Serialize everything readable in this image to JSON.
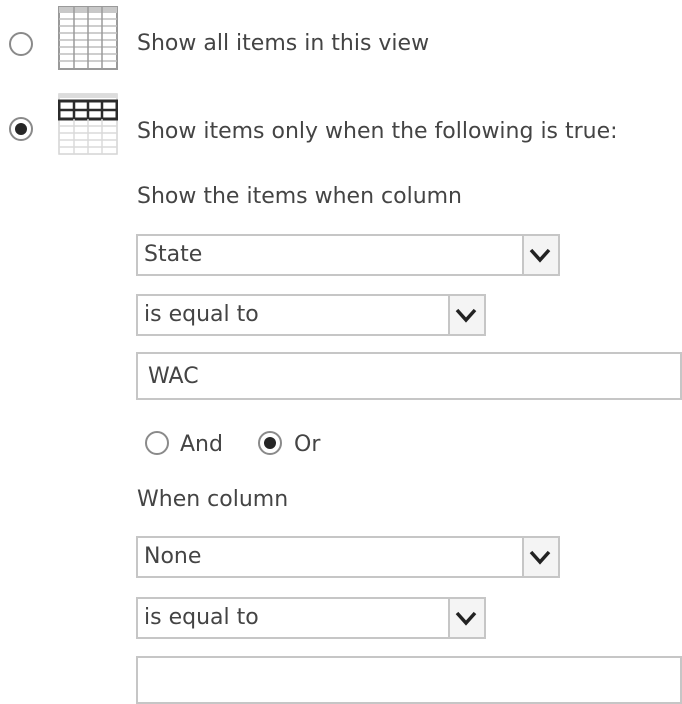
{
  "filter": {
    "show_all": {
      "label": "Show all items in this view",
      "selected": false,
      "icon": "grid-all-icon"
    },
    "show_filtered": {
      "label": "Show items only when the following is true:",
      "selected": true,
      "icon": "grid-filtered-icon"
    },
    "condition1": {
      "heading": "Show the items when column",
      "column": "State",
      "operator": "is equal to",
      "value": "WAC"
    },
    "logic": {
      "and_label": "And",
      "and_selected": false,
      "or_label": "Or",
      "or_selected": true
    },
    "condition2": {
      "heading": "When column",
      "column": "None",
      "operator": "is equal to",
      "value": ""
    }
  }
}
